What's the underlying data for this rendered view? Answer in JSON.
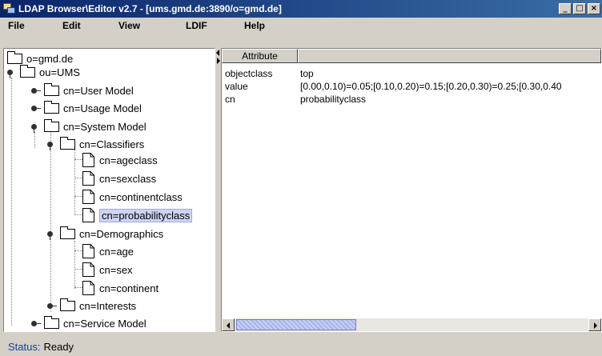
{
  "window": {
    "title": "LDAP Browser\\Editor v2.7 - [ums.gmd.de:3890/o=gmd.de]",
    "controls": [
      "_",
      "□",
      "×"
    ]
  },
  "menu": {
    "items": [
      "File",
      "Edit",
      "View",
      "LDIF",
      "Help"
    ]
  },
  "tree": {
    "nodes": [
      {
        "label": "o=gmd.de",
        "icon": "folder-icon"
      },
      {
        "label": "ou=UMS",
        "icon": "folder-icon",
        "expander": "open"
      },
      {
        "label": "cn=User Model",
        "icon": "folder-icon",
        "expander": "closed"
      },
      {
        "label": "cn=Usage Model",
        "icon": "folder-icon",
        "expander": "closed"
      },
      {
        "label": "cn=System Model",
        "icon": "folder-icon",
        "expander": "open"
      },
      {
        "label": "cn=Classifiers",
        "icon": "folder-icon",
        "expander": "open"
      },
      {
        "label": "cn=ageclass",
        "icon": "leaf-document-icon"
      },
      {
        "label": "cn=sexclass",
        "icon": "leaf-document-icon"
      },
      {
        "label": "cn=continentclass",
        "icon": "leaf-document-icon"
      },
      {
        "label": "cn=probabilityclass",
        "icon": "leaf-document-icon",
        "selected": true
      },
      {
        "label": "cn=Demographics",
        "icon": "folder-icon",
        "expander": "open"
      },
      {
        "label": "cn=age",
        "icon": "leaf-document-icon"
      },
      {
        "label": "cn=sex",
        "icon": "leaf-document-icon"
      },
      {
        "label": "cn=continent",
        "icon": "leaf-document-icon"
      },
      {
        "label": "cn=Interests",
        "icon": "folder-icon",
        "expander": "closed"
      },
      {
        "label": "cn=Service Model",
        "icon": "folder-icon",
        "expander": "closed"
      }
    ]
  },
  "attributes": {
    "header": "Attribute",
    "rows": [
      {
        "name": "objectclass",
        "value": "top"
      },
      {
        "name": "value",
        "value": "[0.00,0.10)=0.05;[0.10,0.20)=0.15;[0.20,0.30)=0.25;[0.30,0.40"
      },
      {
        "name": "cn",
        "value": "probabilityclass"
      }
    ]
  },
  "status": {
    "label": "Status:",
    "text": "Ready"
  },
  "colors": {
    "titlebar_start": "#0a246a",
    "titlebar_end": "#3a6ea5",
    "selection": "#cfd3f5",
    "status_label": "#1f3aa0"
  }
}
